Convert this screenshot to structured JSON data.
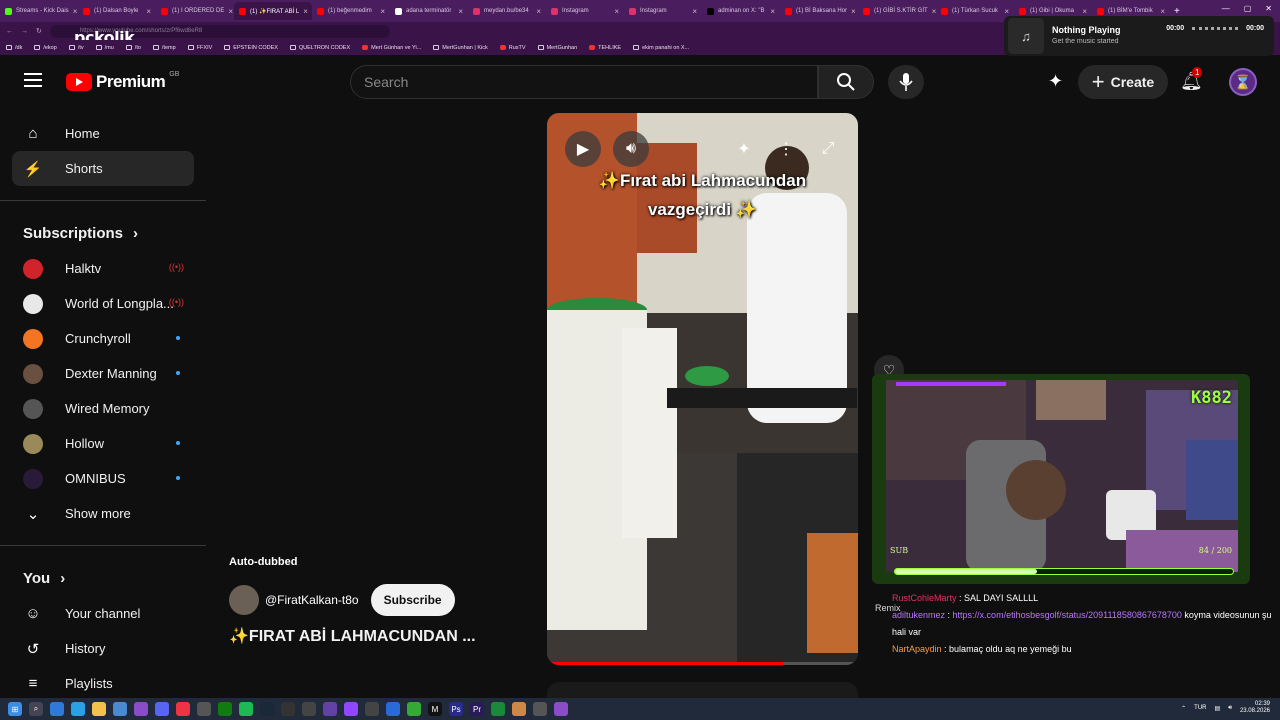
{
  "browser": {
    "tabs": [
      {
        "label": "Streams - Kick Dais",
        "color": "#53fc18"
      },
      {
        "label": "(1) Dalsan Boyle",
        "color": "#ff0000"
      },
      {
        "label": "(1) I ORDERED DE",
        "color": "#ff0000"
      },
      {
        "label": "(1) ✨FIRAT ABİ L",
        "color": "#ff0000",
        "active": true
      },
      {
        "label": "(1) beğenmedim",
        "color": "#ff0000"
      },
      {
        "label": "adana terminatör",
        "color": "#ffffff"
      },
      {
        "label": "meydan.bu/be34",
        "color": "#e1306c"
      },
      {
        "label": "Instagram",
        "color": "#e1306c"
      },
      {
        "label": "Instagram",
        "color": "#e1306c"
      },
      {
        "label": "adminan on X: \"B",
        "color": "#000000"
      },
      {
        "label": "(1) Bİ Baksana Hor",
        "color": "#ff0000"
      },
      {
        "label": "(1) GİBİ S.KTİR GİT",
        "color": "#ff0000"
      },
      {
        "label": "(1) Türkan Sucuk",
        "color": "#ff0000"
      },
      {
        "label": "(1) Gibi | Okuma",
        "color": "#ff0000"
      },
      {
        "label": "(1) BİM'e Tombik",
        "color": "#ff0000"
      }
    ],
    "new_tab": "+",
    "url": "https://www.youtube.com/shorts/zrPf6wd8eR8",
    "overlay_logo": "pckolik",
    "bookmarks": [
      {
        "label": "/dk",
        "type": "folder"
      },
      {
        "label": "/ekop",
        "type": "folder"
      },
      {
        "label": "/tv",
        "type": "folder"
      },
      {
        "label": "/mu",
        "type": "folder"
      },
      {
        "label": "/to",
        "type": "folder"
      },
      {
        "label": "/temp",
        "type": "folder"
      },
      {
        "label": "FFXIV",
        "type": "folder"
      },
      {
        "label": "EPSTEIN CODEX",
        "type": "folder"
      },
      {
        "label": "QUELTRON CODEX",
        "type": "folder"
      },
      {
        "label": "Mert Günhan ve Yi...",
        "type": "yt"
      },
      {
        "label": "MertGunhan | Kick",
        "type": "kick"
      },
      {
        "label": "RusTV",
        "type": "yt"
      },
      {
        "label": "MertGunhan",
        "type": "gh"
      },
      {
        "label": "TEHLIKE",
        "type": "yt"
      },
      {
        "label": "ekim panahi on X...",
        "type": "x"
      }
    ]
  },
  "media_widget": {
    "title": "Nothing Playing",
    "subtitle": "Get the music started",
    "time_start": "00:00",
    "time_end": "00:00"
  },
  "youtube": {
    "logo_word": "Premium",
    "region": "GB",
    "search_placeholder": "Search",
    "create_label": "Create",
    "notification_count": "1",
    "sidebar": {
      "main": [
        {
          "label": "Home",
          "icon": "home-icon",
          "glyph": "⌂"
        },
        {
          "label": "Shorts",
          "icon": "shorts-icon",
          "glyph": "⚡",
          "active": true
        }
      ],
      "subscriptions_header": "Subscriptions",
      "subscriptions": [
        {
          "label": "Halktv",
          "color": "#d1232a",
          "status": "live"
        },
        {
          "label": "World of Longpla...",
          "color": "#e8e8e8",
          "status": "live"
        },
        {
          "label": "Crunchyroll",
          "color": "#f47521",
          "status": "new"
        },
        {
          "label": "Dexter Manning",
          "color": "#6a5040",
          "status": "new"
        },
        {
          "label": "Wired Memory",
          "color": "#555555",
          "status": "none"
        },
        {
          "label": "Hollow",
          "color": "#9a8a5a",
          "status": "new"
        },
        {
          "label": "OMNIBUS",
          "color": "#2a1a3a",
          "status": "new"
        }
      ],
      "show_more": "Show more",
      "you_header": "You",
      "you_items": [
        {
          "label": "Your channel",
          "icon": "channel-icon",
          "glyph": "☺"
        },
        {
          "label": "History",
          "icon": "history-icon",
          "glyph": "↺"
        },
        {
          "label": "Playlists",
          "icon": "playlists-icon",
          "glyph": "≡"
        }
      ]
    },
    "short": {
      "caption_line1": "✨Fırat abi Lahmacundan",
      "caption_line2": "vazgeçirdi ✨",
      "progress": 0.76,
      "auto_dubbed": "Auto-dubbed",
      "channel": "@FiratKalkan-t8o",
      "subscribe_label": "Subscribe",
      "title": "✨FIRAT ABİ LAHMACUNDAN ..."
    }
  },
  "stream_overlay": {
    "counter": "K882",
    "sub_label": "SUB",
    "sub_count": "84 / 200",
    "sub_progress": 0.42,
    "remix_label": "Remix",
    "chat": [
      {
        "user": "RustCohleMarty",
        "text": "SAL DAYI SALLLL",
        "color": "u1"
      },
      {
        "user": "adiltukenmez",
        "text": "koyma videosunun şu hali var",
        "link": "https://x.com/etihosbesgolf/status/2091118580867678700",
        "color": "u2"
      },
      {
        "user": "NartApaydin",
        "text": "bulamaç oldu aq ne yemeği bu",
        "color": "u3"
      }
    ]
  },
  "taskbar": {
    "lang": "TUR",
    "time": "02:39",
    "date": "23.08.2026"
  }
}
